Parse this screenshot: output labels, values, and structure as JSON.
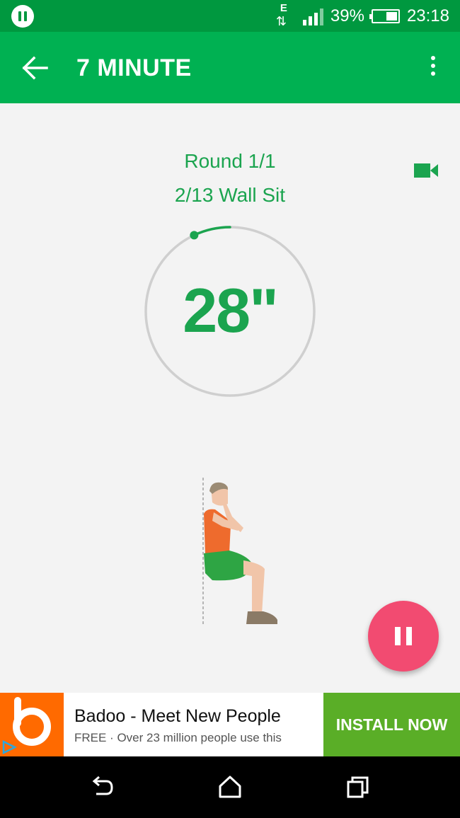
{
  "status_bar": {
    "network_letter": "E",
    "battery": "39%",
    "time": "23:18",
    "icons": [
      "pause-notification-icon",
      "data-transfer-icon",
      "signal-icon",
      "battery-icon"
    ]
  },
  "app_bar": {
    "title": "7 MINUTE",
    "icons": [
      "back-arrow-icon",
      "more-options-icon"
    ]
  },
  "workout": {
    "round": "Round 1/1",
    "exercise": "2/13 Wall Sit",
    "countdown": "28\"",
    "elapsed_fraction": 0.07,
    "icons": [
      "video-icon",
      "pause-icon"
    ]
  },
  "ad": {
    "title": "Badoo - Meet New People",
    "subtitle": "FREE · Over 23 million people use this",
    "button": "INSTALL NOW",
    "icons": [
      "badoo-logo",
      "ad-choices-icon"
    ]
  },
  "nav_bar": {
    "icons": [
      "back-icon",
      "home-icon",
      "recents-icon"
    ]
  },
  "colors": {
    "status_bar": "#00983f",
    "app_bar": "#00b152",
    "accent": "#1ba44f",
    "fab": "#f24b71",
    "ad_install": "#5aae27",
    "ad_logo": "#ff6a00"
  }
}
